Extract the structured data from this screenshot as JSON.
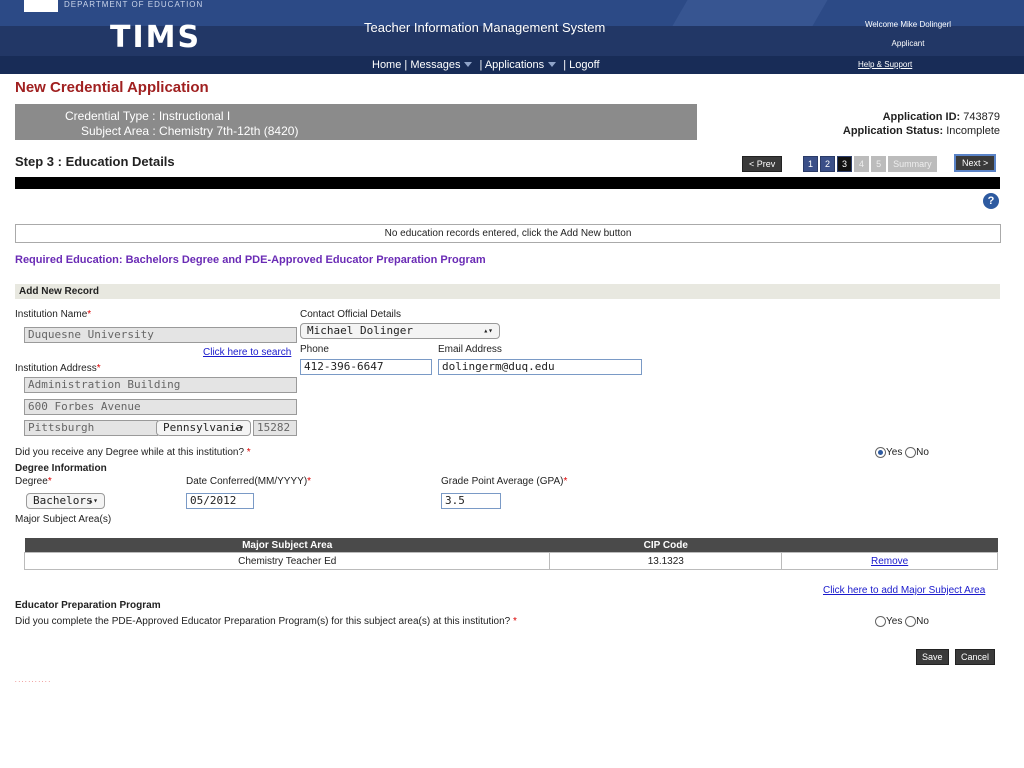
{
  "header": {
    "dept": "DEPARTMENT OF EDUCATION",
    "logo": "TIMS",
    "system_title": "Teacher Information Management System",
    "welcome": "Welcome Mike Dolingerl",
    "role": "Applicant",
    "help_link": "Help & Support",
    "nav": {
      "home": "Home",
      "messages": "Messages",
      "applications": "Applications",
      "logoff": "Logoff",
      "sep": "|"
    }
  },
  "page": {
    "title": "New Credential Application",
    "credential_type": "Credential Type : Instructional I",
    "subject_area": "Subject Area : Chemistry 7th-12th (8420)",
    "app_id_label": "Application ID:",
    "app_id": "743879",
    "app_status_label": "Application Status:",
    "app_status": "Incomplete",
    "step_title": "Step 3 : Education Details",
    "prev": "< Prev",
    "next": "Next >",
    "steps": [
      "1",
      "2",
      "3",
      "4",
      "5",
      "Summary"
    ],
    "help_icon": "?",
    "no_records": "No education records entered, click the Add New button",
    "required_education": "Required Education: Bachelors Degree and PDE-Approved Educator Preparation Program",
    "add_new_record": "Add New Record"
  },
  "form": {
    "institution_name_label": "Institution Name",
    "institution_name": "Duquesne University",
    "search_link": "Click here to search",
    "contact_label": "Contact Official Details",
    "contact_value": "Michael Dolinger",
    "phone_label": "Phone",
    "phone": "412-396-6647",
    "email_label": "Email Address",
    "email": "dolingerm@duq.edu",
    "institution_address_label": "Institution Address",
    "address1": "Administration Building",
    "address2": "600 Forbes Avenue",
    "city": "Pittsburgh",
    "state": "Pennsylvania",
    "zip": "15282",
    "degree_question": "Did you receive any Degree while at this institution?",
    "yes": "Yes",
    "no": "No",
    "degree_info": "Degree Information",
    "degree_label": "Degree",
    "degree_value": "Bachelors",
    "date_label": "Date Conferred(MM/YYYY)",
    "date_value": "05/2012",
    "gpa_label": "Grade Point Average (GPA)",
    "gpa_value": "3.5",
    "major_label": "Major Subject Area(s)",
    "table": {
      "headers": [
        "Major Subject Area",
        "CIP Code",
        ""
      ],
      "rows": [
        {
          "subject": "Chemistry Teacher Ed",
          "cip": "13.1323",
          "action": "Remove"
        }
      ]
    },
    "add_major_link": "Click here to add Major Subject Area",
    "prep_title": "Educator Preparation Program",
    "prep_question": "Did you complete the PDE-Approved Educator Preparation Program(s) for this subject area(s) at this institution?",
    "save": "Save",
    "cancel": "Cancel",
    "asterisk": "*"
  },
  "colors": {
    "header_bg": "#233a6c",
    "title_red": "#a02020",
    "purple": "#6a2bb5",
    "link_blue": "#1a1acc"
  }
}
